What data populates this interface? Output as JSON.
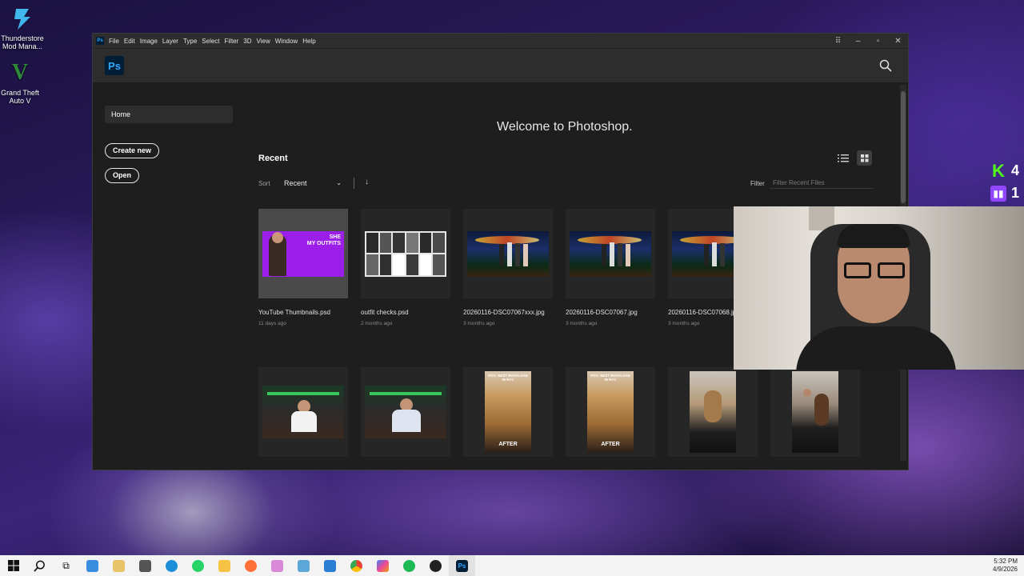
{
  "desktop": {
    "icons": [
      {
        "label": "Thunderstore Mod Mana..."
      },
      {
        "label": "Grand Theft Auto V"
      }
    ]
  },
  "overlay": {
    "kick_count": "4",
    "twitch_count": "1"
  },
  "window": {
    "menu": [
      "File",
      "Edit",
      "Image",
      "Layer",
      "Type",
      "Select",
      "Filter",
      "3D",
      "View",
      "Window",
      "Help"
    ]
  },
  "app": {
    "logo": "Ps",
    "sidebar": {
      "home": "Home",
      "create_new": "Create new",
      "open": "Open"
    },
    "welcome": "Welcome to Photoshop.",
    "recent": {
      "title": "Recent",
      "sort_label": "Sort",
      "sort_value": "Recent",
      "filter_label": "Filter",
      "filter_placeholder": "Filter Recent Files",
      "files": [
        {
          "name": "YouTube Thumbnails.psd",
          "date": "11 days ago"
        },
        {
          "name": "outfit checks.psd",
          "date": "2 months ago"
        },
        {
          "name": "20260116-DSC07067xxx.jpg",
          "date": "3 months ago"
        },
        {
          "name": "20260116-DSC07067.jpg",
          "date": "3 months ago"
        },
        {
          "name": "20260116-DSC07068.jpg",
          "date": "3 months ago"
        }
      ],
      "thumb_text": {
        "yt_line1": "SHE",
        "yt_line2": "MY OUTFITS",
        "hair_top": "POV: BEST BAYALAGE IN NYC",
        "hair_after": "AFTER"
      }
    }
  },
  "taskbar": {
    "time": "5:32 PM",
    "date": "4/9/2026"
  }
}
